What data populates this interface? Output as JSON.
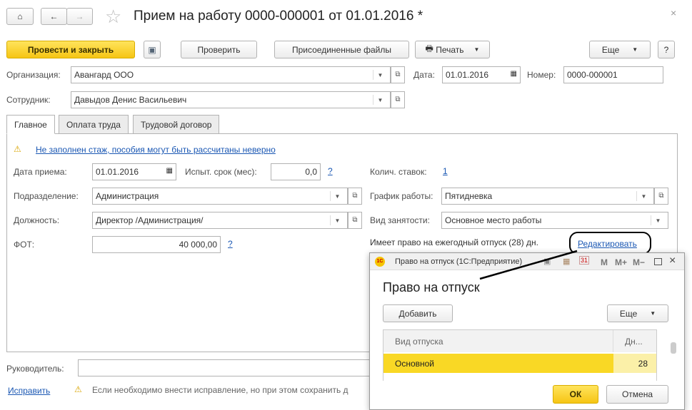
{
  "header": {
    "title": "Прием на работу 0000-000001 от 01.01.2016 *"
  },
  "toolbar": {
    "post_close": "Провести и закрыть",
    "check": "Проверить",
    "files": "Присоединенные файлы",
    "print": "Печать",
    "more": "Еще",
    "help": "?"
  },
  "org": {
    "label": "Организация:",
    "value": "Авангард ООО"
  },
  "date": {
    "label": "Дата:",
    "value": "01.01.2016"
  },
  "number": {
    "label": "Номер:",
    "value": "0000-000001"
  },
  "employee": {
    "label": "Сотрудник:",
    "value": "Давыдов Денис Васильевич"
  },
  "tabs": [
    "Главное",
    "Оплата труда",
    "Трудовой договор"
  ],
  "warning": "Не заполнен стаж, пособия могут быть рассчитаны неверно",
  "main": {
    "hire_date_label": "Дата приема:",
    "hire_date": "01.01.2016",
    "probation_label": "Испыт. срок (мес):",
    "probation": "0,0",
    "q": "?",
    "rates_label": "Колич. ставок:",
    "rates": "1",
    "dept_label": "Подразделение:",
    "dept": "Администрация",
    "schedule_label": "График работы:",
    "schedule": "Пятидневка",
    "position_label": "Должность:",
    "position": "Директор /Администрация/",
    "employment_label": "Вид занятости:",
    "employment": "Основное место работы",
    "fot_label": "ФОТ:",
    "fot": "40 000,00",
    "vacation_text": "Имеет право на ежегодный отпуск (28) дн.",
    "edit_link": "Редактировать"
  },
  "footer": {
    "manager_label": "Руководитель:",
    "fix_link": "Исправить",
    "fix_note": "Если необходимо внести исправление, но при этом сохранить д"
  },
  "dialog": {
    "window_title": "Право на отпуск  (1С:Предприятие)",
    "title": "Право на отпуск",
    "add": "Добавить",
    "more": "Еще",
    "columns": [
      "Вид отпуска",
      "Дн..."
    ],
    "rows": [
      {
        "kind": "Основной",
        "days": "28"
      }
    ],
    "ok": "ОК",
    "cancel": "Отмена",
    "m": "M",
    "mplus": "M+",
    "mminus": "M−"
  }
}
